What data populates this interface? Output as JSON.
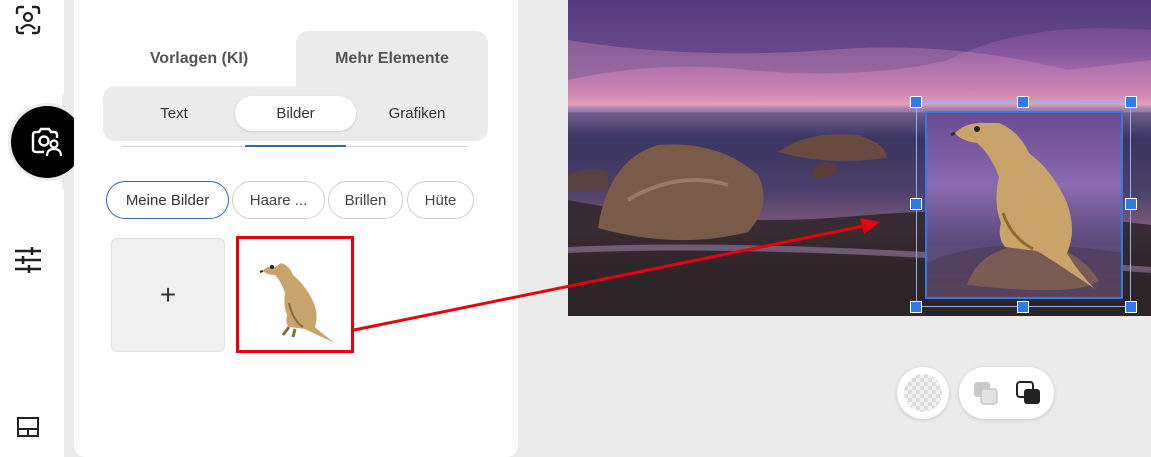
{
  "rail": {
    "icons": [
      "face-scan-icon",
      "photo-person-icon",
      "sliders-icon",
      "layout-icon"
    ]
  },
  "panel": {
    "main_tabs": [
      {
        "label": "Vorlagen (KI)",
        "active": false
      },
      {
        "label": "Mehr Elemente",
        "active": true
      }
    ],
    "sub_tabs": [
      {
        "label": "Text",
        "active": false
      },
      {
        "label": "Bilder",
        "active": true
      },
      {
        "label": "Grafiken",
        "active": false
      }
    ],
    "chips": [
      {
        "label": "Meine Bilder",
        "active": true
      },
      {
        "label": "Haare ...",
        "active": false
      },
      {
        "label": "Brillen",
        "active": false
      },
      {
        "label": "Hüte",
        "active": false
      }
    ],
    "add_tile_symbol": "+",
    "image_tile_icon": "meerkat-image"
  },
  "canvas": {
    "background_image": "beach-sunset-rocks",
    "selected_element": "meerkat-image"
  },
  "controls": {
    "transparency_icon": "checkerboard-icon",
    "send_backward_icon": "send-backward-icon",
    "bring_forward_icon": "bring-forward-icon"
  },
  "colors": {
    "accent": "#2d7be6",
    "tab_underline": "#2b6cb0",
    "highlight_red": "#e8000b",
    "panel_bg": "#ffffff",
    "page_bg": "#ebebeb"
  }
}
